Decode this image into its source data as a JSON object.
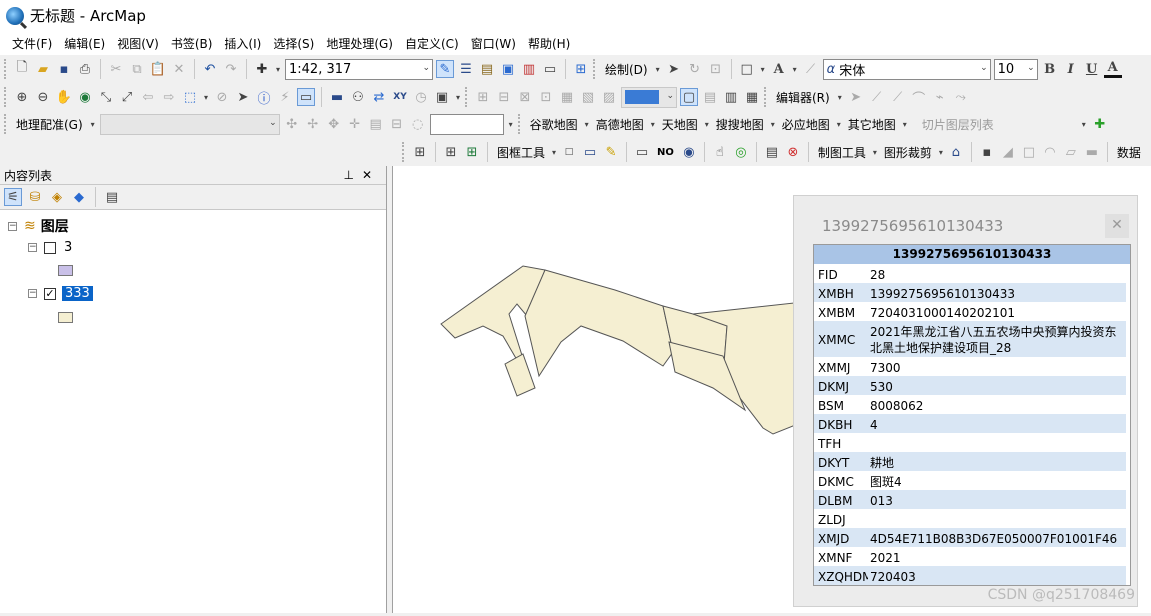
{
  "window": {
    "title": "无标题 - ArcMap"
  },
  "menu": [
    "文件(F)",
    "编辑(E)",
    "视图(V)",
    "书签(B)",
    "插入(I)",
    "选择(S)",
    "地理处理(G)",
    "自定义(C)",
    "窗口(W)",
    "帮助(H)"
  ],
  "toolbar1": {
    "scale": "1:42, 317",
    "draw_label": "绘制(D)",
    "font_name": "宋体",
    "font_size": "10",
    "bold": "B",
    "italic": "I",
    "underline": "U",
    "font_color": "A"
  },
  "toolbar2": {
    "editor_label": "编辑器(R)"
  },
  "toolbar3": {
    "georef_label": "地理配准(G)",
    "maps": [
      "谷歌地图",
      "高德地图",
      "天地图",
      "搜搜地图",
      "必应地图",
      "其它地图"
    ],
    "tile_list_label": "切片图层列表"
  },
  "toolbar4": {
    "frame_tools": "图框工具",
    "no_label": "NO",
    "map_tools": "制图工具",
    "shape_crop": "图形裁剪",
    "data_label": "数据"
  },
  "toc": {
    "title": "内容列表",
    "root": "图层",
    "layers": [
      {
        "name": "3",
        "checked": false,
        "swatch_color": "#c9c0e8"
      },
      {
        "name": "333",
        "checked": true,
        "swatch_color": "#f5efd2"
      }
    ]
  },
  "map": {
    "polygon_fill": "#f5efd2"
  },
  "popup": {
    "title": "1399275695610130433",
    "header": "1399275695610130433",
    "rows": [
      {
        "key": "FID",
        "value": "28"
      },
      {
        "key": "XMBH",
        "value": "1399275695610130433"
      },
      {
        "key": "XMBM",
        "value": "7204031000140202101"
      },
      {
        "key": "XMMC",
        "value": "2021年黑龙江省八五五农场中央预算内投资东北黑土地保护建设项目_28"
      },
      {
        "key": "XMMJ",
        "value": "7300"
      },
      {
        "key": "DKMJ",
        "value": "530"
      },
      {
        "key": "BSM",
        "value": "8008062"
      },
      {
        "key": "DKBH",
        "value": "4"
      },
      {
        "key": "TFH",
        "value": ""
      },
      {
        "key": "DKYT",
        "value": "耕地"
      },
      {
        "key": "DKMC",
        "value": "图斑4"
      },
      {
        "key": "DLBM",
        "value": "013"
      },
      {
        "key": "ZLDJ",
        "value": ""
      },
      {
        "key": "XMJD",
        "value": "4D54E711B08B3D67E050007F01001F46"
      },
      {
        "key": "XMNF",
        "value": "2021"
      },
      {
        "key": "XZQHDM",
        "value": "720403"
      }
    ]
  },
  "watermark": "CSDN @q251708469"
}
